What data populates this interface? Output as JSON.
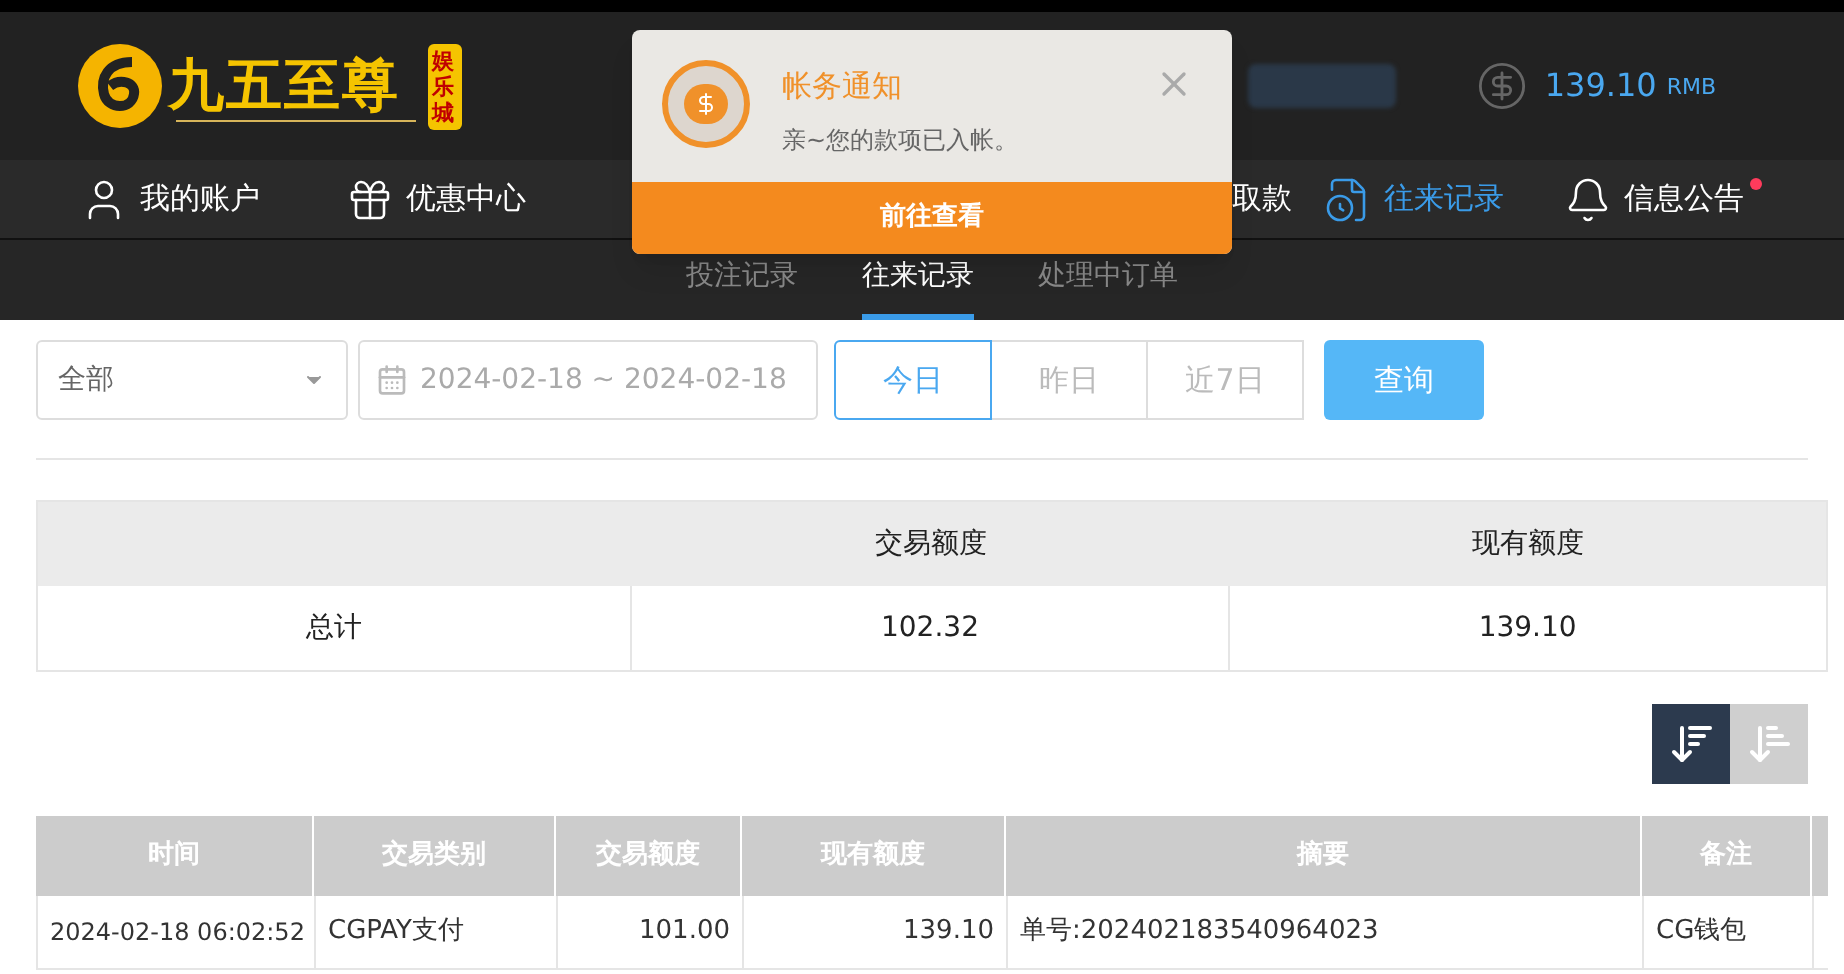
{
  "brand": {
    "name": "九五至尊",
    "badge": "娱乐城"
  },
  "account": {
    "balance": "139.10",
    "currency": "RMB"
  },
  "nav": [
    {
      "label": "我的账户",
      "selected": false,
      "has_badge": false
    },
    {
      "label": "优惠中心",
      "selected": false,
      "has_badge": false
    },
    {
      "label": "取款",
      "selected": false,
      "has_badge": false,
      "kind": "partial"
    },
    {
      "label": "往来记录",
      "selected": true,
      "has_badge": false
    },
    {
      "label": "信息公告",
      "selected": false,
      "has_badge": true
    }
  ],
  "subtabs": [
    {
      "label": "投注记录",
      "selected": false
    },
    {
      "label": "往来记录",
      "selected": true
    },
    {
      "label": "处理中订单",
      "selected": false
    }
  ],
  "notification": {
    "title": "帐务通知",
    "message": "亲~您的款项已入帐。",
    "action": "前往查看"
  },
  "filters": {
    "type_select": {
      "value": "全部"
    },
    "date_range": {
      "value": "2024-02-18 ~ 2024-02-18"
    },
    "quick_ranges": [
      {
        "label": "今日",
        "selected": true
      },
      {
        "label": "昨日",
        "selected": false
      },
      {
        "label": "近7日",
        "selected": false
      }
    ],
    "query_button": "查询"
  },
  "summary": {
    "columns": [
      "交易额度",
      "现有额度"
    ],
    "row": {
      "label": "总计",
      "values": [
        "102.32",
        "139.10"
      ]
    }
  },
  "sort_buttons": [
    {
      "selected": true
    },
    {
      "selected": false
    }
  ],
  "records": {
    "columns": [
      "时间",
      "交易类别",
      "交易额度",
      "现有额度",
      "摘要",
      "备注"
    ],
    "rows": [
      [
        "2024-02-18 06:02:52",
        "CGPAY支付",
        "101.00",
        "139.10",
        "单号:202402183540964023",
        "CG钱包"
      ]
    ]
  }
}
